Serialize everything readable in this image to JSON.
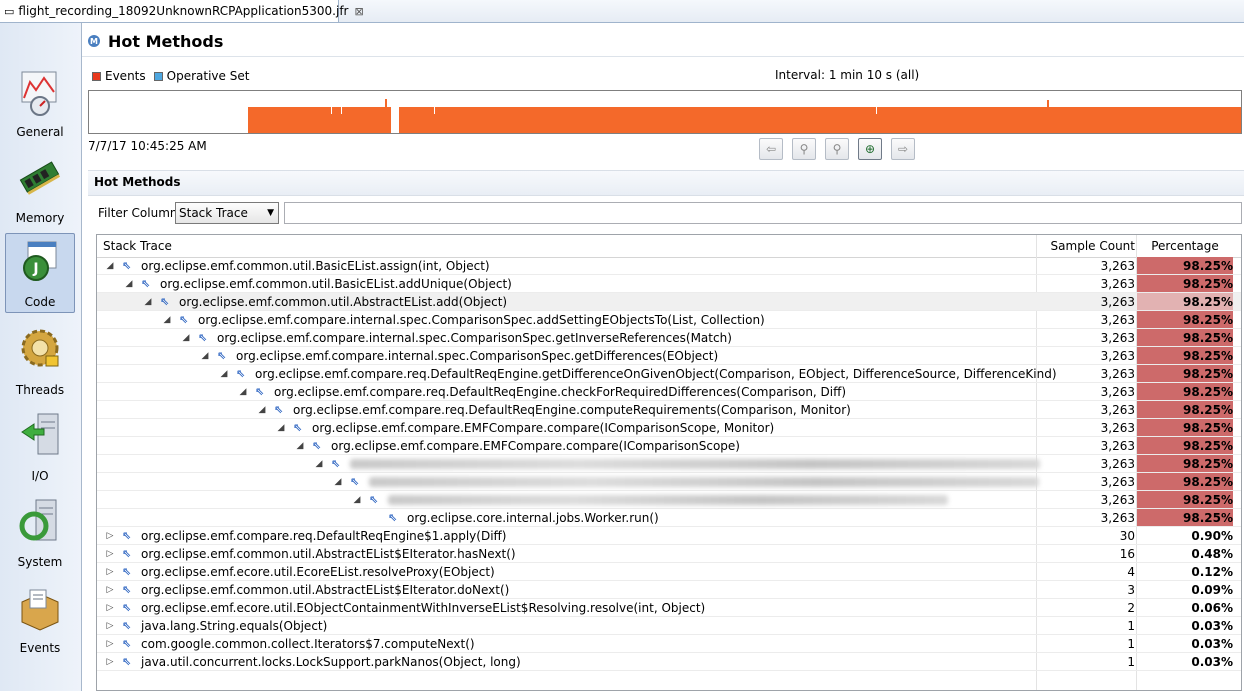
{
  "tab": {
    "title": "flight_recording_18092UnknownRCPApplication5300.jfr",
    "close": "⊠"
  },
  "nav": [
    {
      "label": "General",
      "icon": "general-chart-icon"
    },
    {
      "label": "Memory",
      "icon": "memory-chip-icon"
    },
    {
      "label": "Code",
      "icon": "code-java-icon"
    },
    {
      "label": "Threads",
      "icon": "threads-gear-icon"
    },
    {
      "label": "I/O",
      "icon": "io-server-icon"
    },
    {
      "label": "System",
      "icon": "system-server-icon"
    },
    {
      "label": "Events",
      "icon": "events-box-icon"
    }
  ],
  "header": {
    "title": "Hot Methods",
    "icon_letter": "M"
  },
  "legend": {
    "events": "Events",
    "operative": "Operative Set",
    "events_color": "#e8391d",
    "operative_color": "#4ea7e0"
  },
  "interval": "Interval: 1 min 10 s (all)",
  "timestamp": "7/7/17 10:45:25 AM",
  "section_title": "Hot Methods",
  "filter": {
    "label": "Filter Column",
    "selected": "Stack Trace",
    "text": ""
  },
  "table": {
    "columns": [
      "Stack Trace",
      "Sample Count",
      "Percentage"
    ],
    "rows": [
      {
        "depth": 0,
        "twist": "open",
        "text": "org.eclipse.emf.common.util.BasicEList.assign(int, Object)",
        "count": "3,263",
        "pct": "98.25%",
        "hl": "hi"
      },
      {
        "depth": 1,
        "twist": "open",
        "text": "org.eclipse.emf.common.util.BasicEList.addUnique(Object)",
        "count": "3,263",
        "pct": "98.25%",
        "hl": "hi"
      },
      {
        "depth": 2,
        "twist": "open",
        "text": "org.eclipse.emf.common.util.AbstractEList.add(Object)",
        "count": "3,263",
        "pct": "98.25%",
        "hl": "mid",
        "selected": true
      },
      {
        "depth": 3,
        "twist": "open",
        "text": "org.eclipse.emf.compare.internal.spec.ComparisonSpec.addSettingEObjectsTo(List, Collection)",
        "count": "3,263",
        "pct": "98.25%",
        "hl": "hi"
      },
      {
        "depth": 4,
        "twist": "open",
        "text": "org.eclipse.emf.compare.internal.spec.ComparisonSpec.getInverseReferences(Match)",
        "count": "3,263",
        "pct": "98.25%",
        "hl": "hi"
      },
      {
        "depth": 5,
        "twist": "open",
        "text": "org.eclipse.emf.compare.internal.spec.ComparisonSpec.getDifferences(EObject)",
        "count": "3,263",
        "pct": "98.25%",
        "hl": "hi"
      },
      {
        "depth": 6,
        "twist": "open",
        "text": "org.eclipse.emf.compare.req.DefaultReqEngine.getDifferenceOnGivenObject(Comparison, EObject, DifferenceSource, DifferenceKind)",
        "count": "3,263",
        "pct": "98.25%",
        "hl": "hi"
      },
      {
        "depth": 7,
        "twist": "open",
        "text": "org.eclipse.emf.compare.req.DefaultReqEngine.checkForRequiredDifferences(Comparison, Diff)",
        "count": "3,263",
        "pct": "98.25%",
        "hl": "hi"
      },
      {
        "depth": 8,
        "twist": "open",
        "text": "org.eclipse.emf.compare.req.DefaultReqEngine.computeRequirements(Comparison, Monitor)",
        "count": "3,263",
        "pct": "98.25%",
        "hl": "hi"
      },
      {
        "depth": 9,
        "twist": "open",
        "text": "org.eclipse.emf.compare.EMFCompare.compare(IComparisonScope, Monitor)",
        "count": "3,263",
        "pct": "98.25%",
        "hl": "hi"
      },
      {
        "depth": 10,
        "twist": "open",
        "text": "org.eclipse.emf.compare.EMFCompare.compare(IComparisonScope)",
        "count": "3,263",
        "pct": "98.25%",
        "hl": "hi"
      },
      {
        "depth": 11,
        "twist": "open",
        "text": "",
        "count": "3,263",
        "pct": "98.25%",
        "hl": "hi",
        "blur": true
      },
      {
        "depth": 12,
        "twist": "open",
        "text": "",
        "count": "3,263",
        "pct": "98.25%",
        "hl": "hi",
        "blur": true
      },
      {
        "depth": 13,
        "twist": "open",
        "text": "",
        "count": "3,263",
        "pct": "98.25%",
        "hl": "hi",
        "blur": true
      },
      {
        "depth": 14,
        "twist": "none",
        "text": "org.eclipse.core.internal.jobs.Worker.run()",
        "count": "3,263",
        "pct": "98.25%",
        "hl": "hi"
      },
      {
        "depth": 0,
        "twist": "closed",
        "text": "org.eclipse.emf.compare.req.DefaultReqEngine$1.apply(Diff)",
        "count": "30",
        "pct": "0.90%",
        "hl": "none"
      },
      {
        "depth": 0,
        "twist": "closed",
        "text": "org.eclipse.emf.common.util.AbstractEList$EIterator.hasNext()",
        "count": "16",
        "pct": "0.48%",
        "hl": "none"
      },
      {
        "depth": 0,
        "twist": "closed",
        "text": "org.eclipse.emf.ecore.util.EcoreEList.resolveProxy(EObject)",
        "count": "4",
        "pct": "0.12%",
        "hl": "none"
      },
      {
        "depth": 0,
        "twist": "closed",
        "text": "org.eclipse.emf.common.util.AbstractEList$EIterator.doNext()",
        "count": "3",
        "pct": "0.09%",
        "hl": "none"
      },
      {
        "depth": 0,
        "twist": "closed",
        "text": "org.eclipse.emf.ecore.util.EObjectContainmentWithInverseEList$Resolving.resolve(int, Object)",
        "count": "2",
        "pct": "0.06%",
        "hl": "none"
      },
      {
        "depth": 0,
        "twist": "closed",
        "text": "java.lang.String.equals(Object)",
        "count": "1",
        "pct": "0.03%",
        "hl": "none"
      },
      {
        "depth": 0,
        "twist": "closed",
        "text": "com.google.common.collect.Iterators$7.computeNext()",
        "count": "1",
        "pct": "0.03%",
        "hl": "none"
      },
      {
        "depth": 0,
        "twist": "closed",
        "text": "java.util.concurrent.locks.LockSupport.parkNanos(Object, long)",
        "count": "1",
        "pct": "0.03%",
        "hl": "none"
      }
    ]
  }
}
